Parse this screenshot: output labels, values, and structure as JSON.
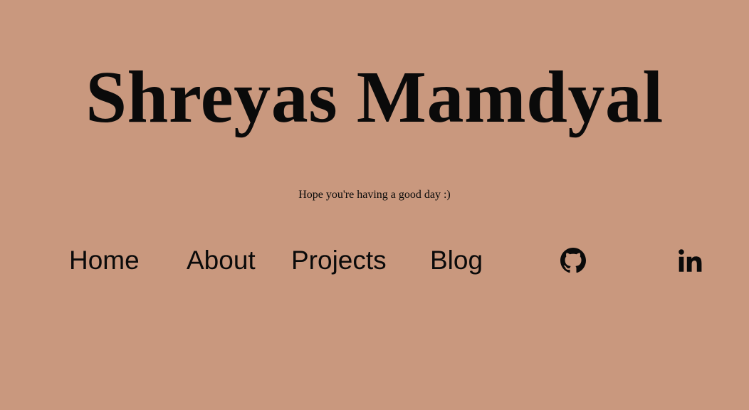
{
  "header": {
    "title": "Shreyas Mamdyal",
    "tagline": "Hope you're having a good day :)"
  },
  "nav": {
    "items": [
      {
        "label": "Home"
      },
      {
        "label": "About"
      },
      {
        "label": "Projects"
      },
      {
        "label": "Blog"
      }
    ],
    "social": [
      {
        "icon": "github-icon"
      },
      {
        "icon": "linkedin-icon"
      }
    ]
  },
  "colors": {
    "background": "#c9987e",
    "text": "#0a0a0a"
  }
}
